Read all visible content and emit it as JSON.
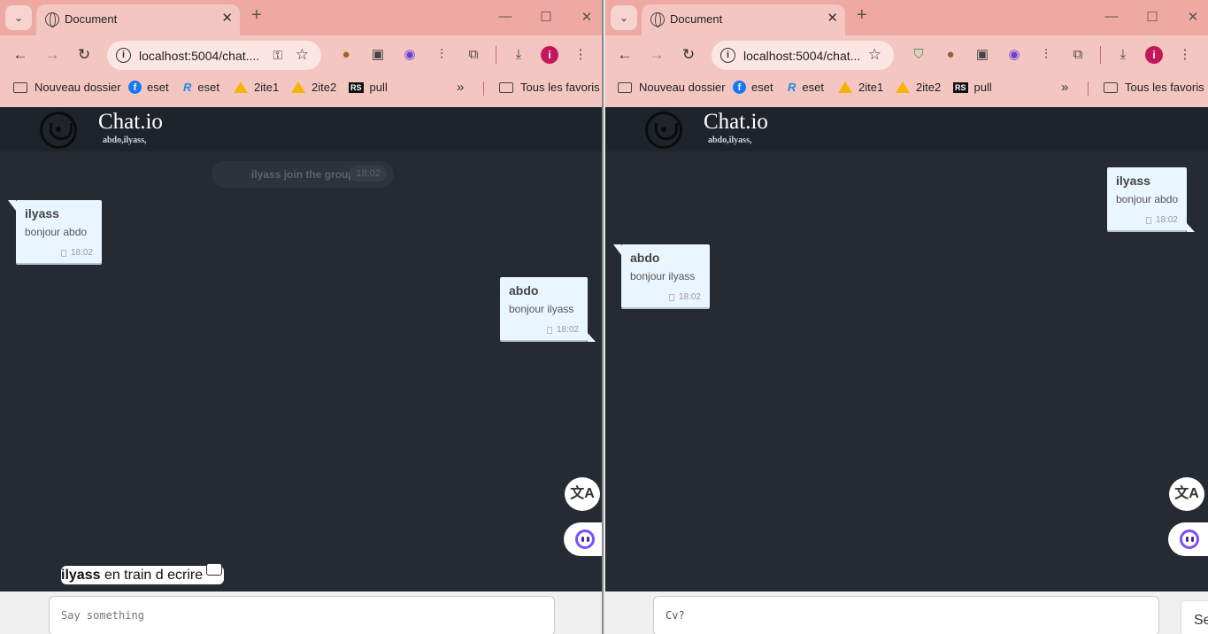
{
  "browser": {
    "tab_title": "Document",
    "url": "localhost:5004/chat....",
    "url_right": "localhost:5004/chat...",
    "bookmarks": [
      {
        "label": "Nouveau dossier"
      },
      {
        "label": "eset"
      },
      {
        "label": "eset"
      },
      {
        "label": "2ite1"
      },
      {
        "label": "2ite2"
      },
      {
        "label": "pull"
      }
    ],
    "all_bookmarks": "Tous les favoris",
    "profile_initial": "i"
  },
  "app": {
    "title": "Chat.io",
    "members": "abdo,ilyass,"
  },
  "left": {
    "system_message": {
      "text": "ilyass join the group",
      "time": "18:02"
    },
    "messages": [
      {
        "sender": "ilyass",
        "text": "bonjour abdo",
        "time": "18:02",
        "side": "left"
      },
      {
        "sender": "abdo",
        "text": "bonjour ilyass",
        "time": "18:02",
        "side": "right"
      }
    ],
    "typing": {
      "user": "ilyass",
      "text": "en train d ecrire"
    },
    "input_placeholder": "Say something"
  },
  "right": {
    "messages": [
      {
        "sender": "ilyass",
        "text": "bonjour abdo",
        "time": "18:02",
        "side": "right"
      },
      {
        "sender": "abdo",
        "text": "bonjour ilyass",
        "time": "18:02",
        "side": "left"
      }
    ],
    "input_value": "Cv?",
    "send_label": "Se"
  },
  "colors": {
    "chrome": "#f4c6c1",
    "tabbar": "#eea9a3",
    "app_bg": "#252a33",
    "bubble": "#eaf6ff"
  }
}
